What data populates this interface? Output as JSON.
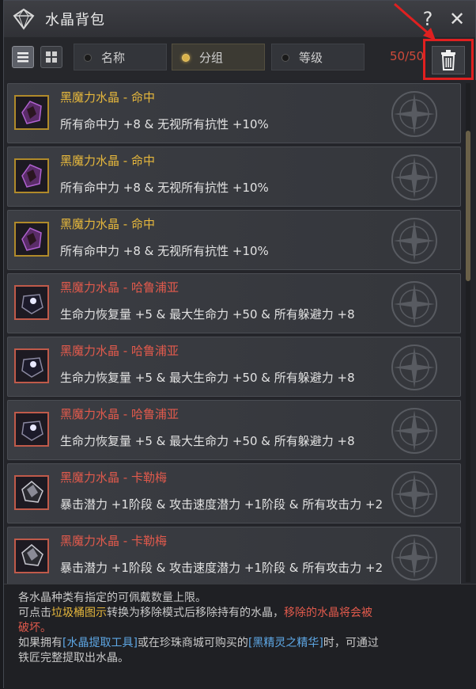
{
  "window": {
    "title": "水晶背包",
    "help_label": "?",
    "close_label": "✕"
  },
  "toolbar": {
    "view_list_icon": "list-icon",
    "view_grid_icon": "grid-icon",
    "sort_options": [
      "名称",
      "分组",
      "等级"
    ],
    "selected_sort": "分组",
    "count": "50/50",
    "trash_icon": "trash-icon"
  },
  "items": [
    {
      "name": "黑魔力水晶 - 命中",
      "desc": "所有命中力 +8 & 无视所有抗性 +10%",
      "rarity": "gold"
    },
    {
      "name": "黑魔力水晶 - 命中",
      "desc": "所有命中力 +8 & 无视所有抗性 +10%",
      "rarity": "gold"
    },
    {
      "name": "黑魔力水晶 - 命中",
      "desc": "所有命中力 +8 & 无视所有抗性 +10%",
      "rarity": "gold"
    },
    {
      "name": "黑魔力水晶 - 哈鲁浦亚",
      "desc": "生命力恢复量 +5 & 最大生命力 +50 & 所有躲避力 +8",
      "rarity": "red"
    },
    {
      "name": "黑魔力水晶 - 哈鲁浦亚",
      "desc": "生命力恢复量 +5 & 最大生命力 +50 & 所有躲避力 +8",
      "rarity": "red"
    },
    {
      "name": "黑魔力水晶 - 哈鲁浦亚",
      "desc": "生命力恢复量 +5 & 最大生命力 +50 & 所有躲避力 +8",
      "rarity": "red"
    },
    {
      "name": "黑魔力水晶 - 卡勒梅",
      "desc": "暴击潜力 +1阶段 & 攻击速度潜力 +1阶段 & 所有攻击力 +2",
      "rarity": "red"
    },
    {
      "name": "黑魔力水晶 - 卡勒梅",
      "desc": "暴击潜力 +1阶段 & 攻击速度潜力 +1阶段 & 所有攻击力 +2",
      "rarity": "red"
    }
  ],
  "info": {
    "line1": "各水晶种类有指定的可佩戴数量上限。",
    "line2_a": "可点击",
    "line2_b": "垃圾桶图示",
    "line2_c": "转换为移除模式后移除持有的水晶，",
    "line2_d": "移除的水晶将会被",
    "line2_e": "破坏。",
    "line3_a": "如果拥有",
    "line3_b": "[水晶提取工具]",
    "line3_c": "或在珍珠商城可购买的",
    "line3_d": "[黑精灵之精华]",
    "line3_e": "时，可通过",
    "line3_f": "铁匠完整提取出水晶。"
  },
  "colors": {
    "gold": "#e7b83c",
    "red": "#e25a4c",
    "blue": "#5ea8e6",
    "highlight_box": "#e02020"
  }
}
